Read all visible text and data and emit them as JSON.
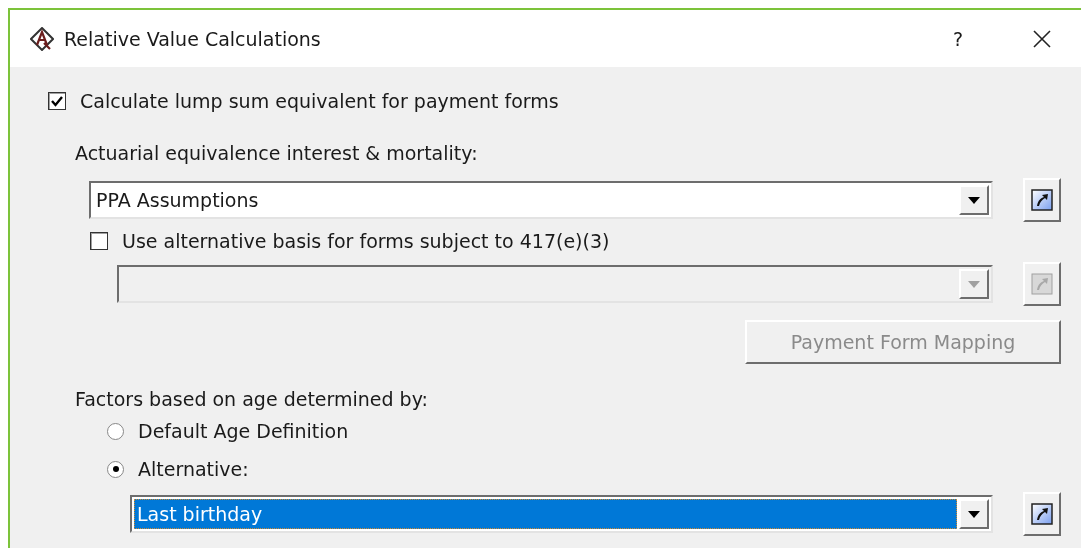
{
  "window": {
    "title": "Relative Value Calculations",
    "help": "?"
  },
  "lump_sum": {
    "label": "Calculate lump sum equivalent for payment forms",
    "checked": true
  },
  "equivalence": {
    "label": "Actuarial equivalence interest & mortality:",
    "combo": {
      "value": "PPA Assumptions",
      "disabled": false
    }
  },
  "alternative_basis": {
    "label": "Use alternative basis for forms subject to 417(e)(3)",
    "checked": false,
    "combo": {
      "disabled": true
    }
  },
  "mapping_button": {
    "label": "Payment Form Mapping",
    "disabled": true
  },
  "age": {
    "label": "Factors based on age determined by:",
    "options": [
      {
        "label": "Default Age Definition",
        "selected": false
      },
      {
        "label": "Alternative:",
        "selected": true
      }
    ],
    "combo": {
      "value": "Last birthday",
      "disabled": false,
      "focused": true
    }
  }
}
